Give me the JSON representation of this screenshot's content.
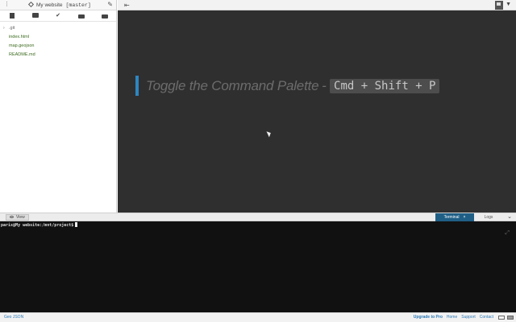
{
  "sidebar": {
    "header": {
      "menu_icon": "vertical-dots-icon",
      "project_name": "My website",
      "branch": "[master]",
      "settings_icon": "wrench-icon"
    },
    "toolbar": {
      "new_file_icon": "new-file-icon",
      "new_folder_icon": "new-folder-icon",
      "commit_icon": "checkmark-icon",
      "upload_icon": "upload-icon",
      "download_icon": "download-icon"
    },
    "tree": [
      {
        "name": ".git",
        "type": "folder"
      },
      {
        "name": "index.html",
        "type": "file"
      },
      {
        "name": "map.geojson",
        "type": "file"
      },
      {
        "name": "README.md",
        "type": "file"
      }
    ]
  },
  "topbar": {
    "exit_icon": "exit-icon",
    "avatar": "user-avatar",
    "menu_caret": "▼"
  },
  "editor": {
    "hint_text": "Toggle the Command Palette",
    "hint_separator": "-",
    "hint_keys": "Cmd + Shift + P"
  },
  "panel": {
    "view_button": "View",
    "tabs": [
      {
        "label": "Terminal",
        "active": true,
        "close": "×"
      },
      {
        "label": "Logs",
        "active": false
      }
    ],
    "toggle": "⌄"
  },
  "terminal": {
    "prompt": "paris@My website:/mnt/project$"
  },
  "status": {
    "mode": "Geo JSON",
    "links": {
      "upgrade": "Upgrade to Pro",
      "home": "Home",
      "support": "Support",
      "contact": "Contact"
    }
  },
  "colors": {
    "accent": "#2e86c1",
    "terminal_tab": "#1f5f86",
    "editor_bg": "#2f2f2f",
    "terminal_bg": "#111111",
    "link": "#2b78b5",
    "file": "#3b6b1e"
  }
}
